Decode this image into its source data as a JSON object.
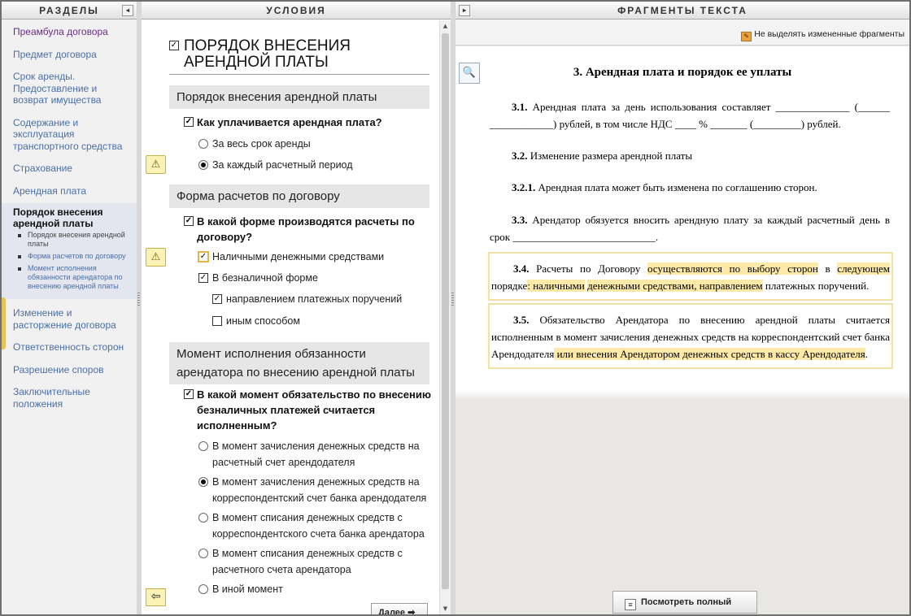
{
  "left": {
    "header": "РАЗДЕЛЫ",
    "collapse": "◂",
    "items": [
      {
        "label": "Преамбула договора"
      },
      {
        "label": "Предмет договора"
      },
      {
        "label": "Срок аренды. Предоставление и возврат имущества"
      },
      {
        "label": "Содержание и эксплуатация транспортного средства"
      },
      {
        "label": "Страхование"
      },
      {
        "label": "Арендная плата"
      }
    ],
    "active": {
      "title": "Порядок внесения арендной платы",
      "sub": [
        "Порядок внесения арендной платы",
        "Форма расчетов по договору",
        "Момент исполнения обязанности арендатора по внесению арендной платы"
      ]
    },
    "items_after": [
      {
        "label": "Изменение и расторжение договора"
      },
      {
        "label": "Ответственность сторон"
      },
      {
        "label": "Разрешение споров"
      },
      {
        "label": "Заключительные положения"
      }
    ]
  },
  "mid": {
    "header": "УСЛОВИЯ",
    "section_title": "ПОРЯДОК ВНЕСЕНИЯ АРЕНДНОЙ ПЛАТЫ",
    "groups": [
      {
        "title": "Порядок внесения арендной платы",
        "question": "Как уплачивается арендная плата?",
        "options": [
          "За весь срок аренды",
          "За каждый расчетный период"
        ]
      },
      {
        "title": "Форма расчетов  по договору",
        "question": "В какой форме производятся расчеты по договору?",
        "options": [
          "Наличными денежными средствами",
          "В безналичной форме",
          "направлением платежных поручений",
          "иным способом"
        ]
      },
      {
        "title": "Момент исполнения обязанности арендатора по внесению арендной платы",
        "question": "В какой момент обязательство по внесению безналичных платежей считается исполненным?",
        "options": [
          "В момент зачисления денежных средств на расчетный счет арендодателя",
          "В момент зачисления денежных средств на корреспондентский счет банка арендодателя",
          "В момент списания денежных средств с корреспондентского счета банка арендатора",
          "В момент списания денежных средств с расчетного счета арендатора",
          "В иной момент"
        ]
      }
    ],
    "next_label": "Далее ➡"
  },
  "right": {
    "header": "ФРАГМЕНТЫ ТЕКСТА",
    "expand": "▸",
    "highlight_toggle": "Не выделять измененные фрагменты",
    "doc_title": "3.  Арендная плата и порядок ее уплаты",
    "p31_num": "3.1.",
    "p31_text": " Арендная плата за день использования составляет ______________ (______ ____________) рублей, в том числе НДС ____ % _______ (_________) рублей.",
    "p32_num": "3.2.",
    "p32_text": " Изменение размера арендной платы",
    "p321_num": "3.2.1.",
    "p321_text": " Арендная плата может быть изменена по соглашению сторон.",
    "p33_num": "3.3.",
    "p33_text": " Арендатор обязуется вносить арендную плату за каждый расчетный день в срок ___________________________.",
    "p34_num": "3.4.",
    "p34_a": " Расчеты по Договору ",
    "p34_b": "осуществляются по выбору сторон",
    "p34_c": " в ",
    "p34_d": "следующем",
    "p34_e": " порядке",
    "p34_f": ": наличными",
    "p34_g": " ",
    "p34_h": "денежными средствами, направлением",
    "p34_i": " платежных поручений.",
    "p35_num": "3.5.",
    "p35_a": " Обязательство Арендатора по внесению арендной платы считается исполненным в момент зачисления денежных средств на корреспондентский счет банка Арендодателя",
    "p35_b": " или внесения Арендатором денежных средств в кассу Арендодателя",
    "p35_c": ".",
    "full_text_button": "Посмотреть полный текст"
  },
  "colors": {
    "highlight": "#fde9a8",
    "link": "#4a6fa8",
    "visited": "#6a2c8a",
    "warning": "#fbf2b6"
  },
  "icons": [
    "collapse-left-icon",
    "checkbox-icon",
    "radio-icon",
    "warning-icon",
    "back-arrow-icon",
    "expand-right-icon",
    "highlight-toggle-icon",
    "document-preview-icon"
  ]
}
